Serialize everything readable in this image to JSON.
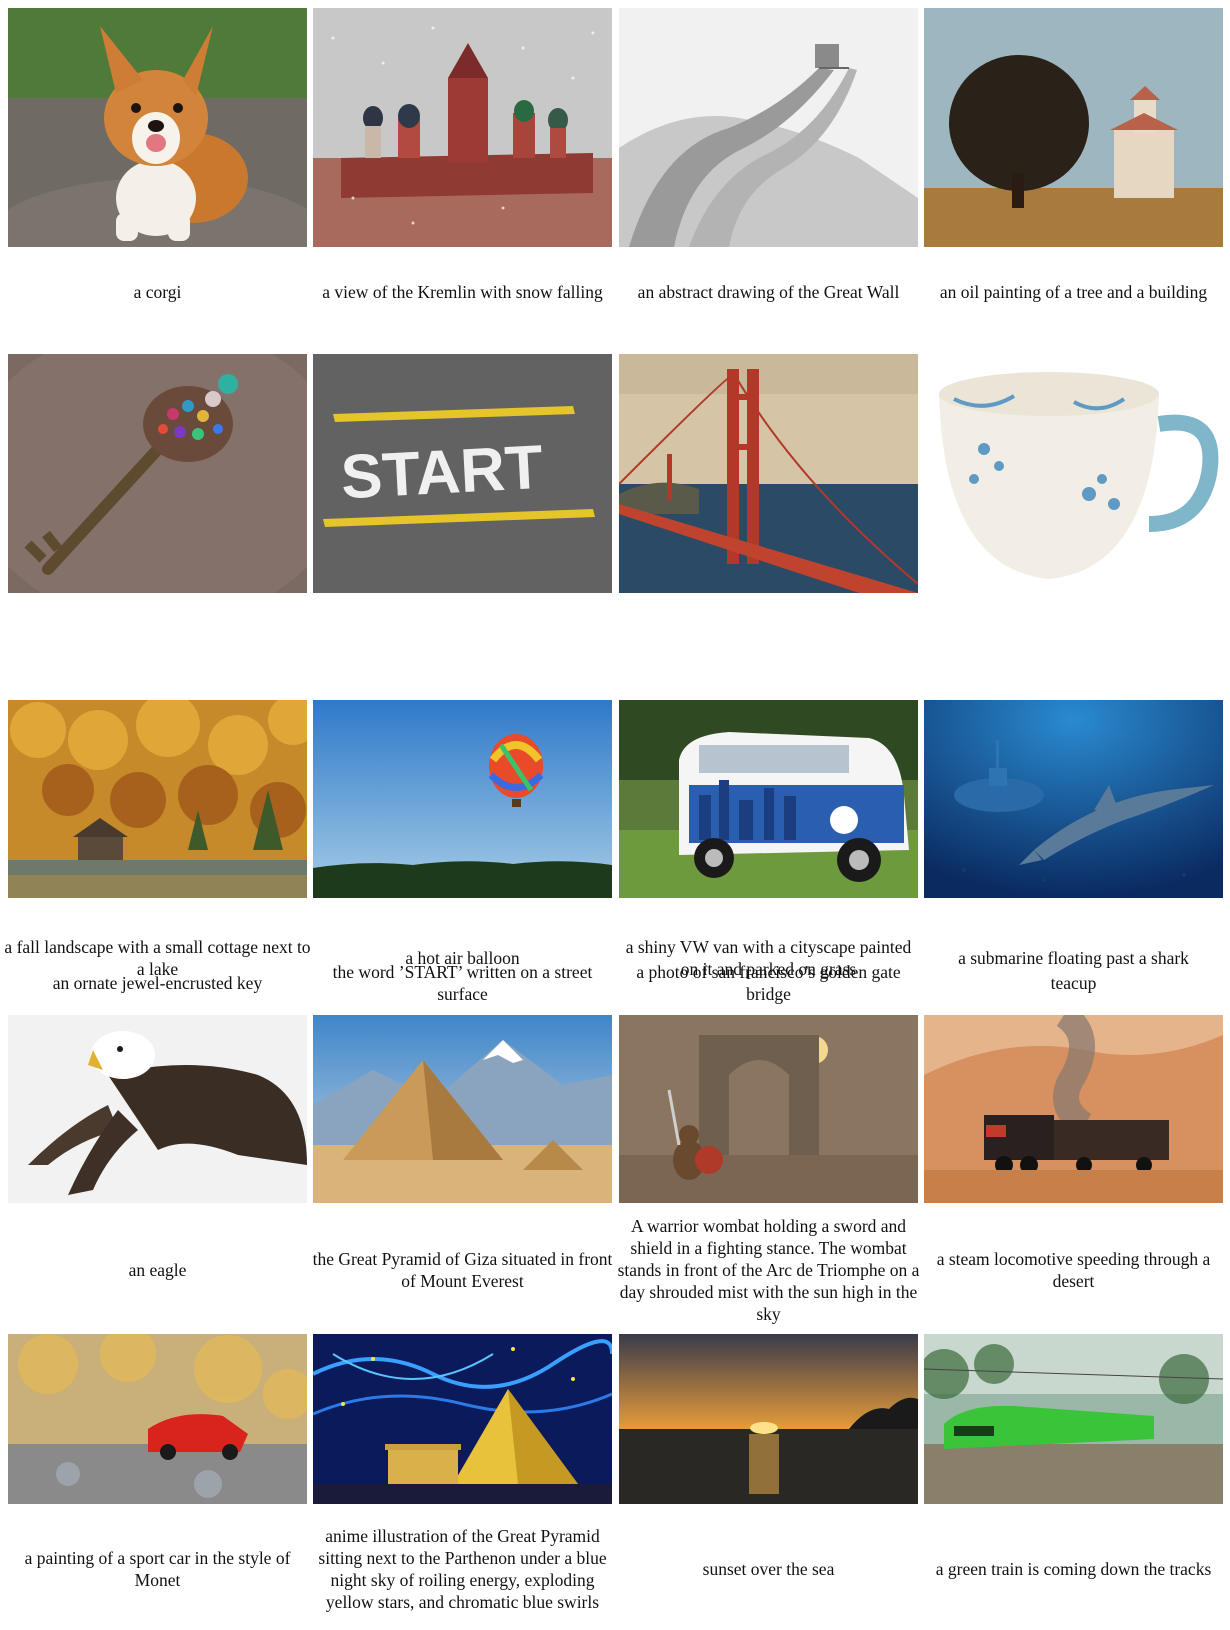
{
  "images": [
    {
      "id": "corgi",
      "caption": "a corgi"
    },
    {
      "id": "kremlin",
      "caption": "a view of the Kremlin with snow falling"
    },
    {
      "id": "great-wall",
      "caption": "an abstract drawing of the Great Wall"
    },
    {
      "id": "tree-building",
      "caption": "an oil painting of a tree and a building"
    },
    {
      "id": "key",
      "caption": "an ornate jewel-encrusted key"
    },
    {
      "id": "start",
      "caption": "the word ’START’ written on a street surface",
      "image_text": "START"
    },
    {
      "id": "golden-gate",
      "caption": "a photo of san francisco’s golden gate bridge"
    },
    {
      "id": "teacup",
      "caption": "teacup"
    },
    {
      "id": "fall-cottage",
      "caption": "a fall landscape with a small cottage next to a lake"
    },
    {
      "id": "balloon",
      "caption": "a hot air balloon"
    },
    {
      "id": "vw-van",
      "caption": "a shiny VW van with a cityscape painted on it and parked on grass"
    },
    {
      "id": "submarine",
      "caption": "a submarine floating past a shark"
    },
    {
      "id": "eagle",
      "caption": "an eagle"
    },
    {
      "id": "pyramid-everest",
      "caption": "the Great Pyramid of Giza situated in front of Mount Everest"
    },
    {
      "id": "wombat",
      "caption": "A warrior wombat holding a sword and shield in a fighting stance. The wombat stands in front of the Arc de Triomphe on a day shrouded mist with the sun high in the sky"
    },
    {
      "id": "locomotive",
      "caption": "a steam locomotive speeding through a desert"
    },
    {
      "id": "sport-car",
      "caption": "a painting of a sport car in the style of Monet"
    },
    {
      "id": "anime-pyramid",
      "caption": "anime illustration of the Great Pyramid sitting next to the Parthenon under a blue night sky of roiling energy, exploding yellow stars, and chromatic blue swirls"
    },
    {
      "id": "sunset",
      "caption": "sunset over the sea"
    },
    {
      "id": "green-train",
      "caption": "a green train is coming down the tracks"
    }
  ]
}
